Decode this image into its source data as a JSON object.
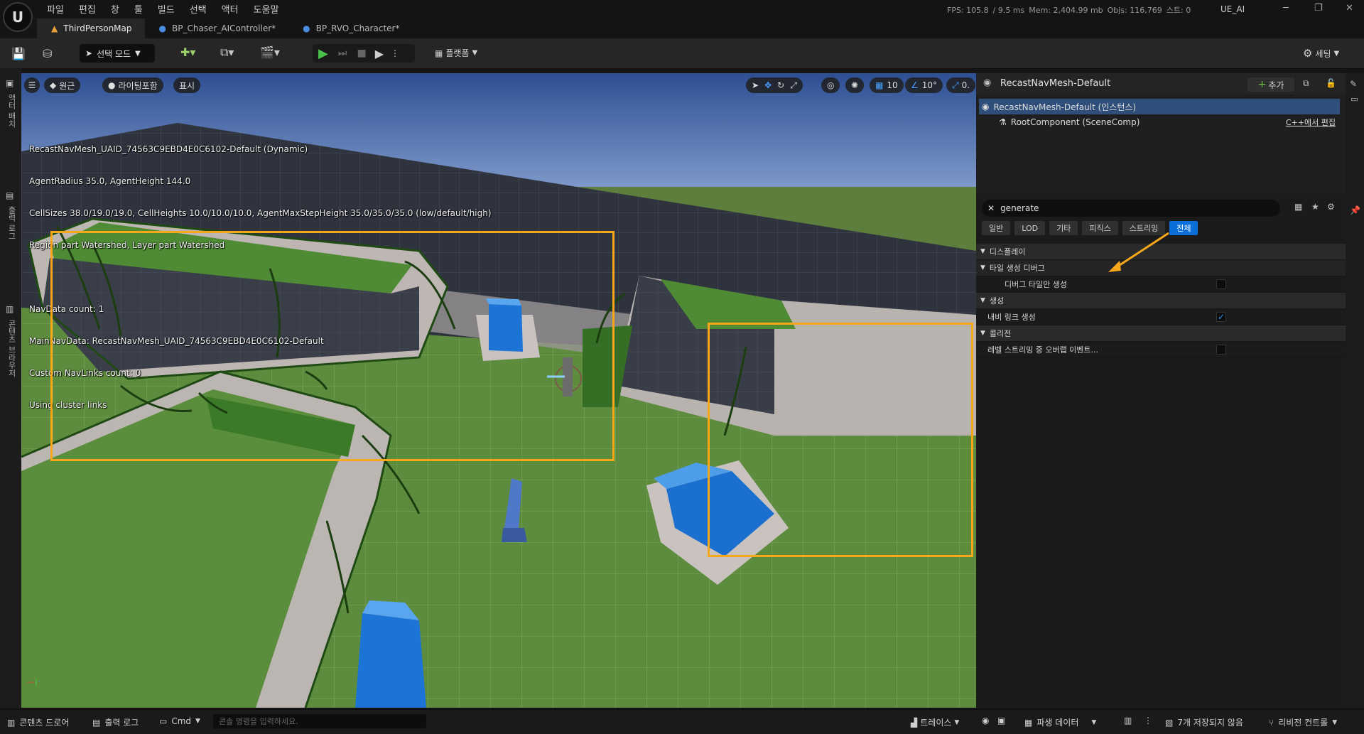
{
  "titlebar": {
    "menu": [
      "파일",
      "편집",
      "창",
      "툴",
      "빌드",
      "선택",
      "액터",
      "도움말"
    ],
    "stats": {
      "fps": "FPS: 105.8",
      "ms": "/ 9.5 ms",
      "mem": "Mem: 2,404.99 mb",
      "objs": "Objs: 116,769",
      "streaming": "스트: 0"
    },
    "project": "UE_AI"
  },
  "tabs": [
    {
      "label": "ThirdPersonMap",
      "icon": "level-icon"
    },
    {
      "label": "BP_Chaser_AIController*",
      "icon": "controller-icon"
    },
    {
      "label": "BP_RVO_Character*",
      "icon": "character-icon"
    }
  ],
  "toolbar": {
    "mode_label": "선택 모드",
    "platform_label": "플랫폼",
    "settings_label": "세팅"
  },
  "leftstrip": {
    "items": [
      "액터 배치",
      "출력 로그",
      "콘텐츠 브라우저"
    ]
  },
  "viewport": {
    "menu_icon": "hamburger-icon",
    "perspective_label": "원근",
    "lighting_label": "라이팅포함",
    "show_label": "표시",
    "grid_snap": "10",
    "rot_snap": "10°",
    "scale_snap": "0.",
    "debug_lines": [
      "RecastNavMesh_UAID_74563C9EBD4E0C6102-Default (Dynamic)",
      "AgentRadius 35.0, AgentHeight 144.0",
      "CellSizes 38.0/19.0/19.0, CellHeights 10.0/10.0/10.0, AgentMaxStepHeight 35.0/35.0/35.0 (low/default/high)",
      "Region part Watershed, Layer part Watershed",
      "",
      "NavData count: 1",
      "MainNavData: RecastNavMesh_UAID_74563C9EBD4E0C6102-Default",
      "Custom NavLinks count: 0",
      "Using cluster links"
    ]
  },
  "details": {
    "title": "RecastNavMesh-Default",
    "add_label": "추가",
    "tree": [
      {
        "label": "RecastNavMesh-Default (인스턴스)"
      },
      {
        "label": "RootComponent (SceneComp)",
        "action": "C++에서 편집"
      }
    ],
    "search_value": "generate",
    "filter_tabs": [
      "일반",
      "LOD",
      "기타",
      "피직스",
      "스트리밍",
      "전체"
    ],
    "active_filter": "전체",
    "properties": [
      {
        "type": "category",
        "label": "디스플레이"
      },
      {
        "type": "subcategory",
        "label": "타일 생성 디버그"
      },
      {
        "type": "prop",
        "label": "디버그 타일만 생성",
        "checked": false,
        "indent": true
      },
      {
        "type": "category",
        "label": "생성"
      },
      {
        "type": "prop",
        "label": "내비 링크 생성",
        "checked": true,
        "indent": false
      },
      {
        "type": "category",
        "label": "콜리전"
      },
      {
        "type": "prop",
        "label": "레벨 스트리밍 중 오버랩 이벤트...",
        "checked": false,
        "indent": false
      }
    ]
  },
  "statusbar": {
    "content_drawer": "콘텐츠 드로어",
    "output_log": "출력 로그",
    "cmd_label": "Cmd",
    "cmd_placeholder": "콘솔 명령을 입력하세요.",
    "trace_label": "트레이스",
    "derived_data": "파생 데이터",
    "unsaved": "7개 저장되지 않음",
    "revision": "리비전 컨트롤"
  },
  "colors": {
    "accent": "#0a6fd8",
    "selection": "#f7a71a",
    "navmesh": "#5c9a3e"
  }
}
